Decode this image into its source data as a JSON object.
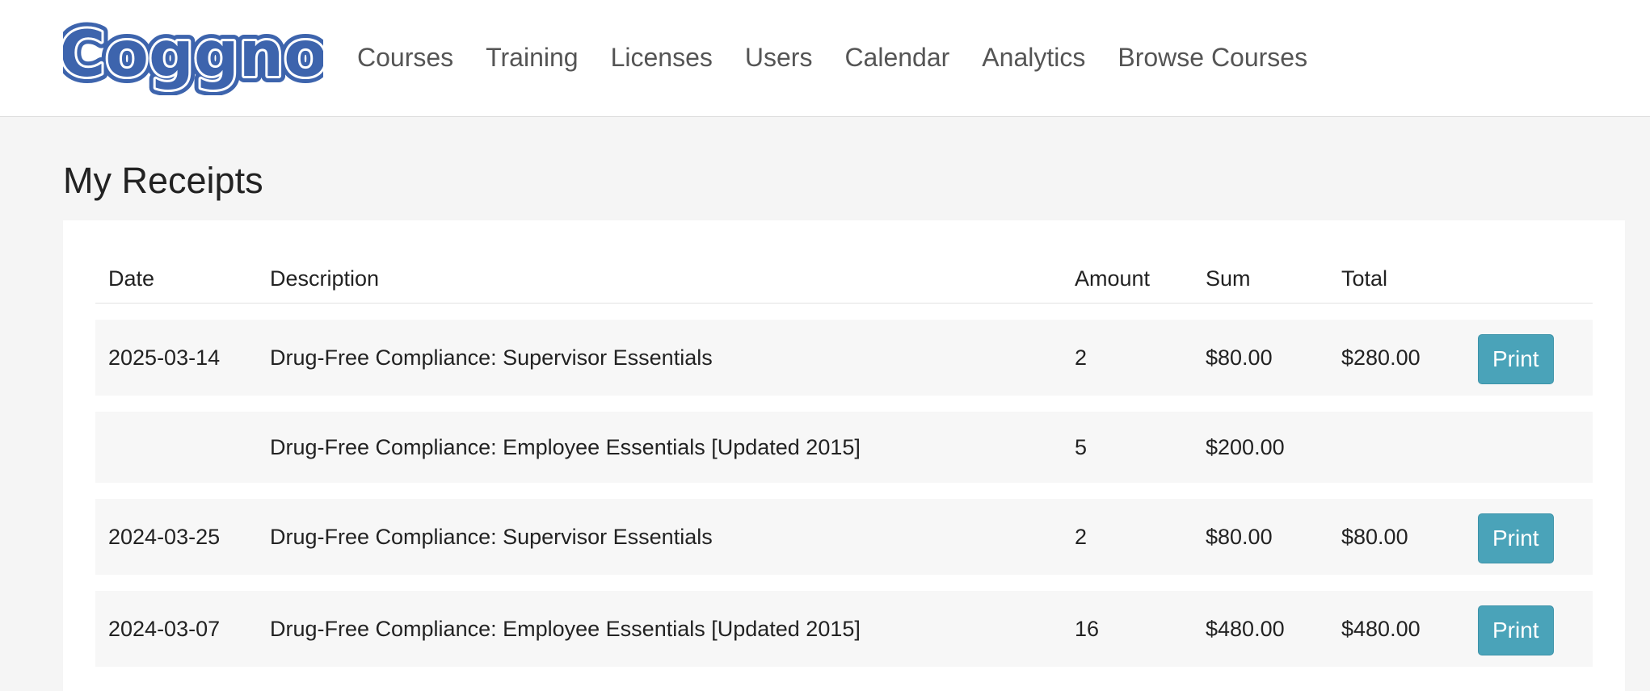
{
  "brand": {
    "logo_text": "Coggno",
    "colors": {
      "logo_blue": "#3d64ad",
      "button": "#4aa3b9",
      "nav_text": "#555555"
    }
  },
  "nav": {
    "items": [
      {
        "label": "Courses"
      },
      {
        "label": "Training"
      },
      {
        "label": "Licenses"
      },
      {
        "label": "Users"
      },
      {
        "label": "Calendar"
      },
      {
        "label": "Analytics"
      },
      {
        "label": "Browse Courses"
      }
    ]
  },
  "page": {
    "title": "My Receipts"
  },
  "table": {
    "headers": {
      "date": "Date",
      "description": "Description",
      "amount": "Amount",
      "sum": "Sum",
      "total": "Total"
    },
    "print_label": "Print",
    "rows": [
      {
        "date": "2025-03-14",
        "description": "Drug-Free Compliance: Supervisor Essentials",
        "amount": "2",
        "sum": "$80.00",
        "total": "$280.00",
        "has_print": true
      },
      {
        "date": "",
        "description": "Drug-Free Compliance: Employee Essentials [Updated 2015]",
        "amount": "5",
        "sum": "$200.00",
        "total": "",
        "has_print": false
      },
      {
        "date": "2024-03-25",
        "description": "Drug-Free Compliance: Supervisor Essentials",
        "amount": "2",
        "sum": "$80.00",
        "total": "$80.00",
        "has_print": true
      },
      {
        "date": "2024-03-07",
        "description": "Drug-Free Compliance: Employee Essentials [Updated 2015]",
        "amount": "16",
        "sum": "$480.00",
        "total": "$480.00",
        "has_print": true
      }
    ]
  }
}
